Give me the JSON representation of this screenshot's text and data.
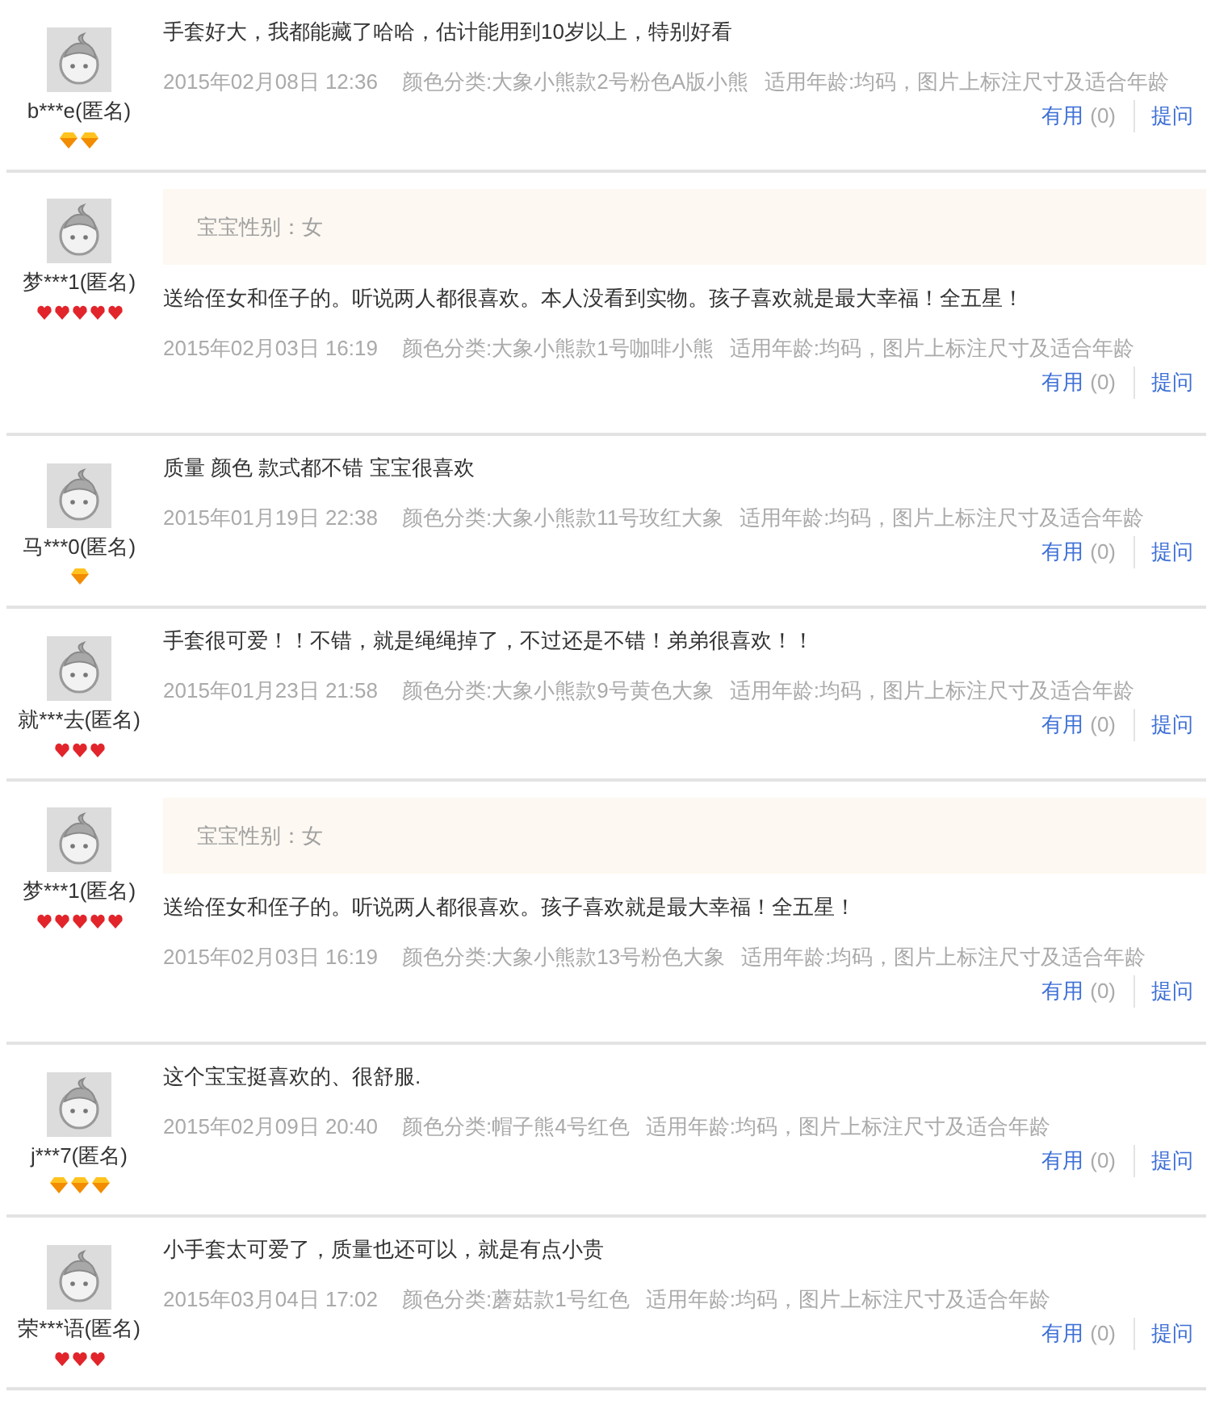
{
  "reviews": [
    {
      "user": "b***e(匿名)",
      "rank_icons": [
        {
          "kind": "diamond"
        },
        {
          "kind": "diamond"
        }
      ],
      "comment": "手套好大，我都能藏了哈哈，估计能用到10岁以上，特别好看",
      "date": "2015年02月08日 12:36",
      "variant": "颜色分类:大象小熊款2号粉色A版小熊",
      "size_note": "适用年龄:均码，图片上标注尺寸及适合年龄",
      "useful_label": "有用",
      "useful_count": "(0)",
      "ask_label": "提问"
    },
    {
      "user": "梦***1(匿名)",
      "rank_icons": [
        {
          "kind": "heart"
        },
        {
          "kind": "heart"
        },
        {
          "kind": "heart"
        },
        {
          "kind": "heart"
        },
        {
          "kind": "heart"
        }
      ],
      "extra_info": "宝宝性别：女",
      "comment": "送给侄女和侄子的。听说两人都很喜欢。本人没看到实物。孩子喜欢就是最大幸福！全五星！",
      "date": "2015年02月03日 16:19",
      "variant": "颜色分类:大象小熊款1号咖啡小熊",
      "size_note": "适用年龄:均码，图片上标注尺寸及适合年龄",
      "useful_label": "有用",
      "useful_count": "(0)",
      "ask_label": "提问"
    },
    {
      "user": "马***0(匿名)",
      "rank_icons": [
        {
          "kind": "diamond"
        }
      ],
      "comment": "质量 颜色 款式都不错 宝宝很喜欢",
      "date": "2015年01月19日 22:38",
      "variant": "颜色分类:大象小熊款11号玫红大象",
      "size_note": "适用年龄:均码，图片上标注尺寸及适合年龄",
      "useful_label": "有用",
      "useful_count": "(0)",
      "ask_label": "提问"
    },
    {
      "user": "就***去(匿名)",
      "rank_icons": [
        {
          "kind": "heart"
        },
        {
          "kind": "heart"
        },
        {
          "kind": "heart"
        }
      ],
      "comment": "手套很可爱！！不错，就是绳绳掉了，不过还是不错！弟弟很喜欢！！",
      "date": "2015年01月23日 21:58",
      "variant": "颜色分类:大象小熊款9号黄色大象",
      "size_note": "适用年龄:均码，图片上标注尺寸及适合年龄",
      "useful_label": "有用",
      "useful_count": "(0)",
      "ask_label": "提问"
    },
    {
      "user": "梦***1(匿名)",
      "rank_icons": [
        {
          "kind": "heart"
        },
        {
          "kind": "heart"
        },
        {
          "kind": "heart"
        },
        {
          "kind": "heart"
        },
        {
          "kind": "heart"
        }
      ],
      "extra_info": "宝宝性别：女",
      "comment": "送给侄女和侄子的。听说两人都很喜欢。孩子喜欢就是最大幸福！全五星！",
      "date": "2015年02月03日 16:19",
      "variant": "颜色分类:大象小熊款13号粉色大象",
      "size_note": "适用年龄:均码，图片上标注尺寸及适合年龄",
      "useful_label": "有用",
      "useful_count": "(0)",
      "ask_label": "提问"
    },
    {
      "user": "j***7(匿名)",
      "rank_icons": [
        {
          "kind": "diamond"
        },
        {
          "kind": "diamond"
        },
        {
          "kind": "diamond"
        }
      ],
      "comment": "这个宝宝挺喜欢的、很舒服.",
      "date": "2015年02月09日 20:40",
      "variant": "颜色分类:帽子熊4号红色",
      "size_note": "适用年龄:均码，图片上标注尺寸及适合年龄",
      "useful_label": "有用",
      "useful_count": "(0)",
      "ask_label": "提问"
    },
    {
      "user": "荣***语(匿名)",
      "rank_icons": [
        {
          "kind": "heart"
        },
        {
          "kind": "heart"
        },
        {
          "kind": "heart"
        }
      ],
      "comment": "小手套太可爱了，质量也还可以，就是有点小贵",
      "date": "2015年03月04日 17:02",
      "variant": "颜色分类:蘑菇款1号红色",
      "size_note": "适用年龄:均码，图片上标注尺寸及适合年龄",
      "useful_label": "有用",
      "useful_count": "(0)",
      "ask_label": "提问"
    }
  ]
}
